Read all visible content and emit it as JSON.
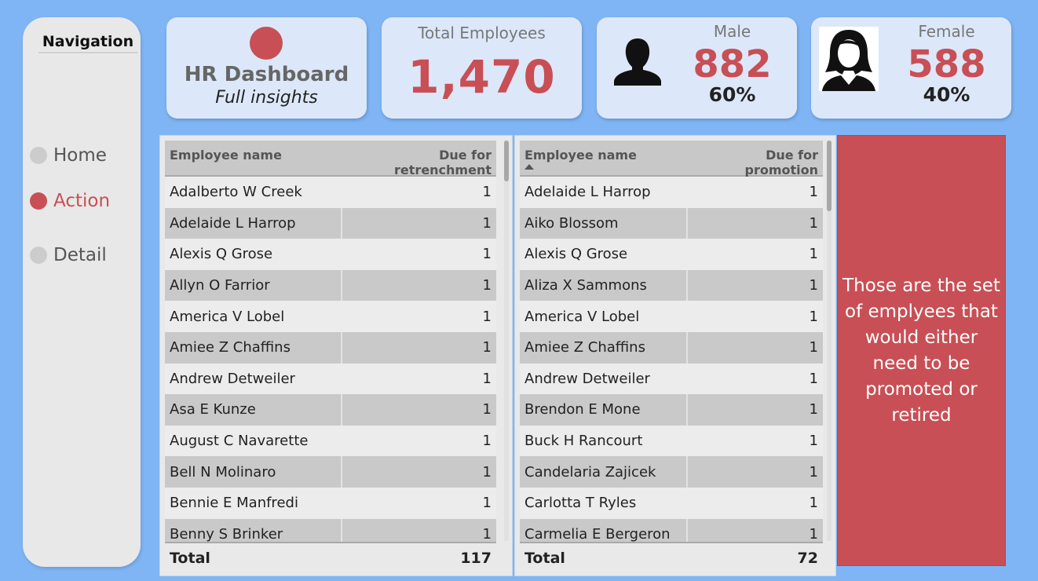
{
  "navigation": {
    "title": "Navigation",
    "items": [
      {
        "label": "Home"
      },
      {
        "label": "Action"
      },
      {
        "label": "Detail"
      }
    ]
  },
  "header": {
    "title": "HR Dashboard",
    "subtitle": "Full insights"
  },
  "kpis": {
    "total": {
      "label": "Total Employees",
      "value": "1,470"
    },
    "male": {
      "label": "Male",
      "value": "882",
      "percent": "60%"
    },
    "female": {
      "label": "Female",
      "value": "588",
      "percent": "40%"
    }
  },
  "retrenchment_table": {
    "col_name": "Employee name",
    "col_value": "Due for retrenchment",
    "rows": [
      {
        "name": "Adalberto W Creek",
        "value": "1"
      },
      {
        "name": "Adelaide L Harrop",
        "value": "1"
      },
      {
        "name": "Alexis Q Grose",
        "value": "1"
      },
      {
        "name": "Allyn O Farrior",
        "value": "1"
      },
      {
        "name": "America V Lobel",
        "value": "1"
      },
      {
        "name": "Amiee Z Chaffins",
        "value": "1"
      },
      {
        "name": "Andrew Detweiler",
        "value": "1"
      },
      {
        "name": "Asa E Kunze",
        "value": "1"
      },
      {
        "name": "August C Navarette",
        "value": "1"
      },
      {
        "name": "Bell N Molinaro",
        "value": "1"
      },
      {
        "name": "Bennie E Manfredi",
        "value": "1"
      },
      {
        "name": "Benny S Brinker",
        "value": "1"
      }
    ],
    "total_label": "Total",
    "total_value": "117"
  },
  "promotion_table": {
    "col_name": "Employee name",
    "col_value": "Due for promotion",
    "rows": [
      {
        "name": "Adelaide L Harrop",
        "value": "1"
      },
      {
        "name": "Aiko Blossom",
        "value": "1"
      },
      {
        "name": "Alexis Q Grose",
        "value": "1"
      },
      {
        "name": "Aliza X Sammons",
        "value": "1"
      },
      {
        "name": "America V Lobel",
        "value": "1"
      },
      {
        "name": "Amiee Z Chaffins",
        "value": "1"
      },
      {
        "name": "Andrew Detweiler",
        "value": "1"
      },
      {
        "name": "Brendon E Mone",
        "value": "1"
      },
      {
        "name": "Buck H Rancourt",
        "value": "1"
      },
      {
        "name": "Candelaria Zajicek",
        "value": "1"
      },
      {
        "name": "Carlotta T Ryles",
        "value": "1"
      },
      {
        "name": "Carmelia E Bergeron",
        "value": "1"
      }
    ],
    "total_label": "Total",
    "total_value": "72"
  },
  "note": {
    "text": "Those are the set of emplyees that would either need to be promoted or retired"
  },
  "colors": {
    "background": "#7fb5f5",
    "accent": "#c84f55",
    "card": "#dce8f9",
    "nav": "#e8e8e8"
  }
}
